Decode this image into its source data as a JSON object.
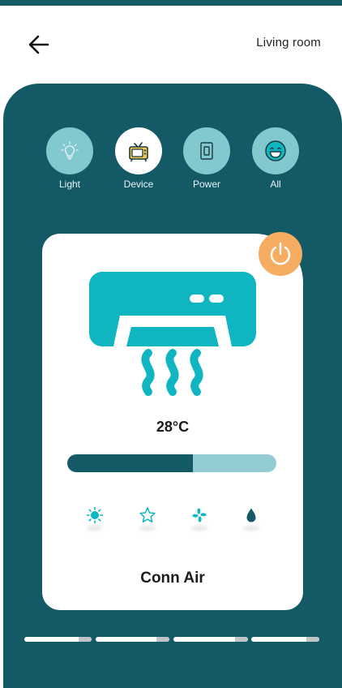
{
  "header": {
    "back_icon": "arrow-left-icon",
    "room_title": "Living room"
  },
  "categories": [
    {
      "label": "Light",
      "icon": "lightbulb-icon",
      "active": false
    },
    {
      "label": "Device",
      "icon": "tv-icon",
      "active": true
    },
    {
      "label": "Power",
      "icon": "switch-icon",
      "active": false
    },
    {
      "label": "All",
      "icon": "smiley-icon",
      "active": false
    }
  ],
  "device_card": {
    "power_icon": "power-icon",
    "device_icon": "air-conditioner-icon",
    "temperature": "28°C",
    "slider_fraction": 0.6,
    "modes": [
      {
        "name": "sun-icon"
      },
      {
        "name": "star-icon"
      },
      {
        "name": "fan-icon"
      },
      {
        "name": "droplet-icon"
      }
    ],
    "device_name": "Conn Air"
  },
  "colors": {
    "panel": "#145a66",
    "accent_light": "#82c8cf",
    "ac_teal": "#0fb6c1",
    "power_orange": "#f6ad62"
  }
}
